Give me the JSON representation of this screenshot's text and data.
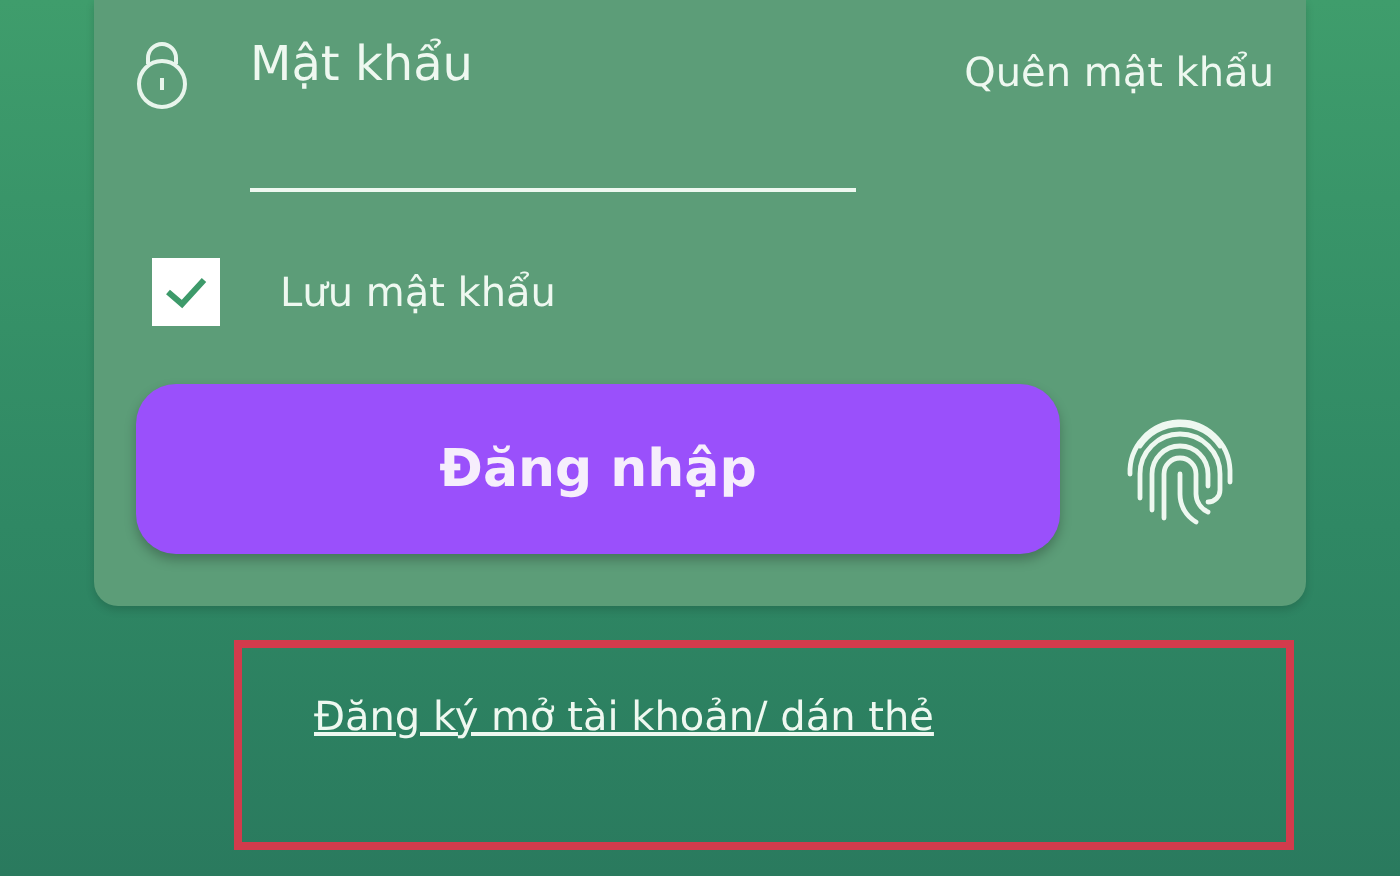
{
  "password": {
    "placeholder": "Mật khẩu",
    "forgot_link": "Quên mật khẩu"
  },
  "remember": {
    "label": "Lưu mật khẩu",
    "checked": true
  },
  "login_button": "Đăng nhập",
  "register_link": "Đăng ký mở tài khoản/ dán thẻ"
}
